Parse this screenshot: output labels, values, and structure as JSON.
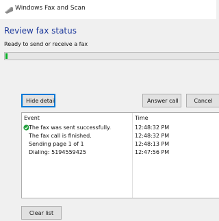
{
  "window": {
    "title": "Windows Fax and Scan",
    "app_icon": "fax-app-icon"
  },
  "heading": "Review fax status",
  "status_text": "Ready to send or receive a fax",
  "progress": {
    "fraction": 0.01,
    "color": "#06b025"
  },
  "buttons": {
    "hide_details": "Hide details",
    "answer_call": "Answer call",
    "cancel": "Cancel",
    "clear_list": "Clear list"
  },
  "events_table": {
    "columns": [
      "Event",
      "Time"
    ],
    "rows": [
      {
        "event": "The fax was sent successfully.",
        "time": "12:48:32 PM",
        "icon": "success-check-icon"
      },
      {
        "event": "The fax call is finished.",
        "time": "12:48:32 PM"
      },
      {
        "event": "Sending page 1 of 1",
        "time": "12:48:13 PM"
      },
      {
        "event": "Dialing: 5194559425",
        "time": "12:47:56 PM"
      }
    ]
  }
}
